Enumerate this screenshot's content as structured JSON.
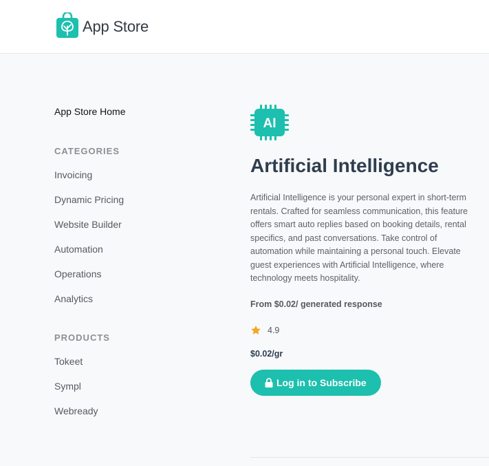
{
  "header": {
    "brand_name": "App Store",
    "logo_icon": "shopping-bag-tree-icon"
  },
  "sidebar": {
    "home_label": "App Store Home",
    "categories_heading": "CATEGORIES",
    "categories": [
      "Invoicing",
      "Dynamic Pricing",
      "Website Builder",
      "Automation",
      "Operations",
      "Analytics"
    ],
    "products_heading": "PRODUCTS",
    "products": [
      "Tokeet",
      "Sympl",
      "Webready"
    ]
  },
  "app": {
    "icon": "ai-chip-icon",
    "icon_text": "AI",
    "title": "Artificial Intelligence",
    "description": "Artificial Intelligence is your personal expert in short-term rentals. Crafted for seamless communication, this feature offers smart auto replies based on booking details, rental specifics, and past conversations. Take control of automation while maintaining a personal touch. Elevate guest experiences with Artificial Intelligence, where technology meets hospitality.",
    "price_from": "From $0.02/ generated response",
    "rating": "4.9",
    "price": "$0.02/gr",
    "subscribe_label": "Log in to Subscribe"
  },
  "colors": {
    "accent": "#1dbfae",
    "star": "#f5a623",
    "title": "#2f3e4e"
  }
}
